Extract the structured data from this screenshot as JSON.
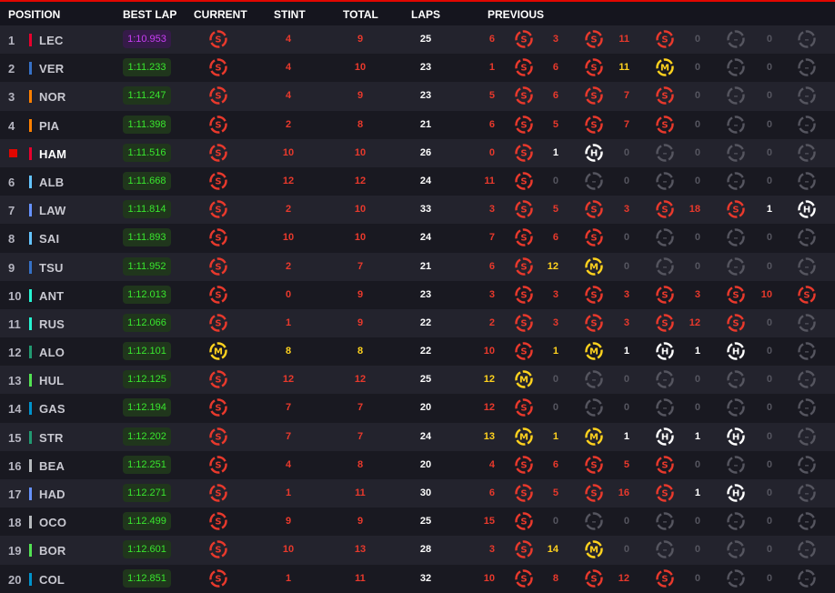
{
  "headers": {
    "position": "POSITION",
    "best_lap": "BEST LAP",
    "current": "CURRENT",
    "stint": "STINT",
    "total": "TOTAL",
    "laps": "LAPS",
    "previous": "PREVIOUS"
  },
  "colors": {
    "accent_red": "#e10600",
    "soft_tyre": "#e8392c",
    "medium_tyre": "#ffd21e",
    "hard_tyre": "#ffffff",
    "unused_tyre": "#55555f",
    "personal_best": "#39e62e",
    "overall_fastest": "#c93ef5"
  },
  "tyre_letters": {
    "S": "S",
    "M": "M",
    "H": "H"
  },
  "drivers": [
    {
      "pos": "1",
      "code": "LEC",
      "team_color": "#e8002d",
      "best_lap": "1:10.953",
      "fastest": true,
      "current": "S",
      "stint": "4",
      "total": "9",
      "laps": "25",
      "previous": [
        {
          "laps": "6",
          "tyre": "S"
        },
        {
          "laps": "3",
          "tyre": "S"
        },
        {
          "laps": "11",
          "tyre": "S"
        },
        {
          "laps": "0",
          "tyre": "-"
        },
        {
          "laps": "0",
          "tyre": "-"
        }
      ]
    },
    {
      "pos": "2",
      "code": "VER",
      "team_color": "#3671c6",
      "best_lap": "1:11.233",
      "current": "S",
      "stint": "4",
      "total": "10",
      "laps": "23",
      "previous": [
        {
          "laps": "1",
          "tyre": "S"
        },
        {
          "laps": "6",
          "tyre": "S"
        },
        {
          "laps": "11",
          "tyre": "M"
        },
        {
          "laps": "0",
          "tyre": "-"
        },
        {
          "laps": "0",
          "tyre": "-"
        }
      ]
    },
    {
      "pos": "3",
      "code": "NOR",
      "team_color": "#ff8000",
      "best_lap": "1:11.247",
      "current": "S",
      "stint": "4",
      "total": "9",
      "laps": "23",
      "previous": [
        {
          "laps": "5",
          "tyre": "S"
        },
        {
          "laps": "6",
          "tyre": "S"
        },
        {
          "laps": "7",
          "tyre": "S"
        },
        {
          "laps": "0",
          "tyre": "-"
        },
        {
          "laps": "0",
          "tyre": "-"
        }
      ]
    },
    {
      "pos": "4",
      "code": "PIA",
      "team_color": "#ff8000",
      "best_lap": "1:11.398",
      "current": "S",
      "stint": "2",
      "total": "8",
      "laps": "21",
      "previous": [
        {
          "laps": "6",
          "tyre": "S"
        },
        {
          "laps": "5",
          "tyre": "S"
        },
        {
          "laps": "7",
          "tyre": "S"
        },
        {
          "laps": "0",
          "tyre": "-"
        },
        {
          "laps": "0",
          "tyre": "-"
        }
      ]
    },
    {
      "pos": "",
      "code": "HAM",
      "team_color": "#e8002d",
      "highlight": true,
      "best_lap": "1:11.516",
      "current": "S",
      "stint": "10",
      "total": "10",
      "laps": "26",
      "previous": [
        {
          "laps": "0",
          "tyre": "S"
        },
        {
          "laps": "1",
          "tyre": "H"
        },
        {
          "laps": "0",
          "tyre": "-"
        },
        {
          "laps": "0",
          "tyre": "-"
        },
        {
          "laps": "0",
          "tyre": "-"
        }
      ]
    },
    {
      "pos": "6",
      "code": "ALB",
      "team_color": "#64c4ff",
      "best_lap": "1:11.668",
      "current": "S",
      "stint": "12",
      "total": "12",
      "laps": "24",
      "previous": [
        {
          "laps": "11",
          "tyre": "S"
        },
        {
          "laps": "0",
          "tyre": "-"
        },
        {
          "laps": "0",
          "tyre": "-"
        },
        {
          "laps": "0",
          "tyre": "-"
        },
        {
          "laps": "0",
          "tyre": "-"
        }
      ]
    },
    {
      "pos": "7",
      "code": "LAW",
      "team_color": "#6692ff",
      "best_lap": "1:11.814",
      "current": "S",
      "stint": "2",
      "total": "10",
      "laps": "33",
      "previous": [
        {
          "laps": "3",
          "tyre": "S"
        },
        {
          "laps": "5",
          "tyre": "S"
        },
        {
          "laps": "3",
          "tyre": "S"
        },
        {
          "laps": "18",
          "tyre": "S"
        },
        {
          "laps": "1",
          "tyre": "H"
        }
      ]
    },
    {
      "pos": "8",
      "code": "SAI",
      "team_color": "#64c4ff",
      "best_lap": "1:11.893",
      "current": "S",
      "stint": "10",
      "total": "10",
      "laps": "24",
      "previous": [
        {
          "laps": "7",
          "tyre": "S"
        },
        {
          "laps": "6",
          "tyre": "S"
        },
        {
          "laps": "0",
          "tyre": "-"
        },
        {
          "laps": "0",
          "tyre": "-"
        },
        {
          "laps": "0",
          "tyre": "-"
        }
      ]
    },
    {
      "pos": "9",
      "code": "TSU",
      "team_color": "#3671c6",
      "best_lap": "1:11.952",
      "current": "S",
      "stint": "2",
      "total": "7",
      "laps": "21",
      "previous": [
        {
          "laps": "6",
          "tyre": "S"
        },
        {
          "laps": "12",
          "tyre": "M"
        },
        {
          "laps": "0",
          "tyre": "-"
        },
        {
          "laps": "0",
          "tyre": "-"
        },
        {
          "laps": "0",
          "tyre": "-"
        }
      ]
    },
    {
      "pos": "10",
      "code": "ANT",
      "team_color": "#27f4d2",
      "best_lap": "1:12.013",
      "current": "S",
      "stint": "0",
      "total": "9",
      "laps": "23",
      "previous": [
        {
          "laps": "3",
          "tyre": "S"
        },
        {
          "laps": "3",
          "tyre": "S"
        },
        {
          "laps": "3",
          "tyre": "S"
        },
        {
          "laps": "3",
          "tyre": "S"
        },
        {
          "laps": "10",
          "tyre": "S"
        }
      ]
    },
    {
      "pos": "11",
      "code": "RUS",
      "team_color": "#27f4d2",
      "best_lap": "1:12.066",
      "current": "S",
      "stint": "1",
      "total": "9",
      "laps": "22",
      "previous": [
        {
          "laps": "2",
          "tyre": "S"
        },
        {
          "laps": "3",
          "tyre": "S"
        },
        {
          "laps": "3",
          "tyre": "S"
        },
        {
          "laps": "12",
          "tyre": "S"
        },
        {
          "laps": "0",
          "tyre": "-"
        }
      ]
    },
    {
      "pos": "12",
      "code": "ALO",
      "team_color": "#229971",
      "best_lap": "1:12.101",
      "current": "M",
      "stint": "8",
      "total": "8",
      "laps": "22",
      "previous": [
        {
          "laps": "10",
          "tyre": "S"
        },
        {
          "laps": "1",
          "tyre": "M"
        },
        {
          "laps": "1",
          "tyre": "H"
        },
        {
          "laps": "1",
          "tyre": "H"
        },
        {
          "laps": "0",
          "tyre": "-"
        }
      ]
    },
    {
      "pos": "13",
      "code": "HUL",
      "team_color": "#52e252",
      "best_lap": "1:12.125",
      "current": "S",
      "stint": "12",
      "total": "12",
      "laps": "25",
      "previous": [
        {
          "laps": "12",
          "tyre": "M"
        },
        {
          "laps": "0",
          "tyre": "-"
        },
        {
          "laps": "0",
          "tyre": "-"
        },
        {
          "laps": "0",
          "tyre": "-"
        },
        {
          "laps": "0",
          "tyre": "-"
        }
      ]
    },
    {
      "pos": "14",
      "code": "GAS",
      "team_color": "#0093cc",
      "best_lap": "1:12.194",
      "current": "S",
      "stint": "7",
      "total": "7",
      "laps": "20",
      "previous": [
        {
          "laps": "12",
          "tyre": "S"
        },
        {
          "laps": "0",
          "tyre": "-"
        },
        {
          "laps": "0",
          "tyre": "-"
        },
        {
          "laps": "0",
          "tyre": "-"
        },
        {
          "laps": "0",
          "tyre": "-"
        }
      ]
    },
    {
      "pos": "15",
      "code": "STR",
      "team_color": "#229971",
      "best_lap": "1:12.202",
      "current": "S",
      "stint": "7",
      "total": "7",
      "laps": "24",
      "previous": [
        {
          "laps": "13",
          "tyre": "M"
        },
        {
          "laps": "1",
          "tyre": "M"
        },
        {
          "laps": "1",
          "tyre": "H"
        },
        {
          "laps": "1",
          "tyre": "H"
        },
        {
          "laps": "0",
          "tyre": "-"
        }
      ]
    },
    {
      "pos": "16",
      "code": "BEA",
      "team_color": "#b6babd",
      "best_lap": "1:12.251",
      "current": "S",
      "stint": "4",
      "total": "8",
      "laps": "20",
      "previous": [
        {
          "laps": "4",
          "tyre": "S"
        },
        {
          "laps": "6",
          "tyre": "S"
        },
        {
          "laps": "5",
          "tyre": "S"
        },
        {
          "laps": "0",
          "tyre": "-"
        },
        {
          "laps": "0",
          "tyre": "-"
        }
      ]
    },
    {
      "pos": "17",
      "code": "HAD",
      "team_color": "#6692ff",
      "best_lap": "1:12.271",
      "current": "S",
      "stint": "1",
      "total": "11",
      "laps": "30",
      "previous": [
        {
          "laps": "6",
          "tyre": "S"
        },
        {
          "laps": "5",
          "tyre": "S"
        },
        {
          "laps": "16",
          "tyre": "S"
        },
        {
          "laps": "1",
          "tyre": "H"
        },
        {
          "laps": "0",
          "tyre": "-"
        }
      ]
    },
    {
      "pos": "18",
      "code": "OCO",
      "team_color": "#b6babd",
      "best_lap": "1:12.499",
      "current": "S",
      "stint": "9",
      "total": "9",
      "laps": "25",
      "previous": [
        {
          "laps": "15",
          "tyre": "S"
        },
        {
          "laps": "0",
          "tyre": "-"
        },
        {
          "laps": "0",
          "tyre": "-"
        },
        {
          "laps": "0",
          "tyre": "-"
        },
        {
          "laps": "0",
          "tyre": "-"
        }
      ]
    },
    {
      "pos": "19",
      "code": "BOR",
      "team_color": "#52e252",
      "best_lap": "1:12.601",
      "current": "S",
      "stint": "10",
      "total": "13",
      "laps": "28",
      "previous": [
        {
          "laps": "3",
          "tyre": "S"
        },
        {
          "laps": "14",
          "tyre": "M"
        },
        {
          "laps": "0",
          "tyre": "-"
        },
        {
          "laps": "0",
          "tyre": "-"
        },
        {
          "laps": "0",
          "tyre": "-"
        }
      ]
    },
    {
      "pos": "20",
      "code": "COL",
      "team_color": "#0093cc",
      "best_lap": "1:12.851",
      "current": "S",
      "stint": "1",
      "total": "11",
      "laps": "32",
      "previous": [
        {
          "laps": "10",
          "tyre": "S"
        },
        {
          "laps": "8",
          "tyre": "S"
        },
        {
          "laps": "12",
          "tyre": "S"
        },
        {
          "laps": "0",
          "tyre": "-"
        },
        {
          "laps": "0",
          "tyre": "-"
        }
      ]
    }
  ]
}
